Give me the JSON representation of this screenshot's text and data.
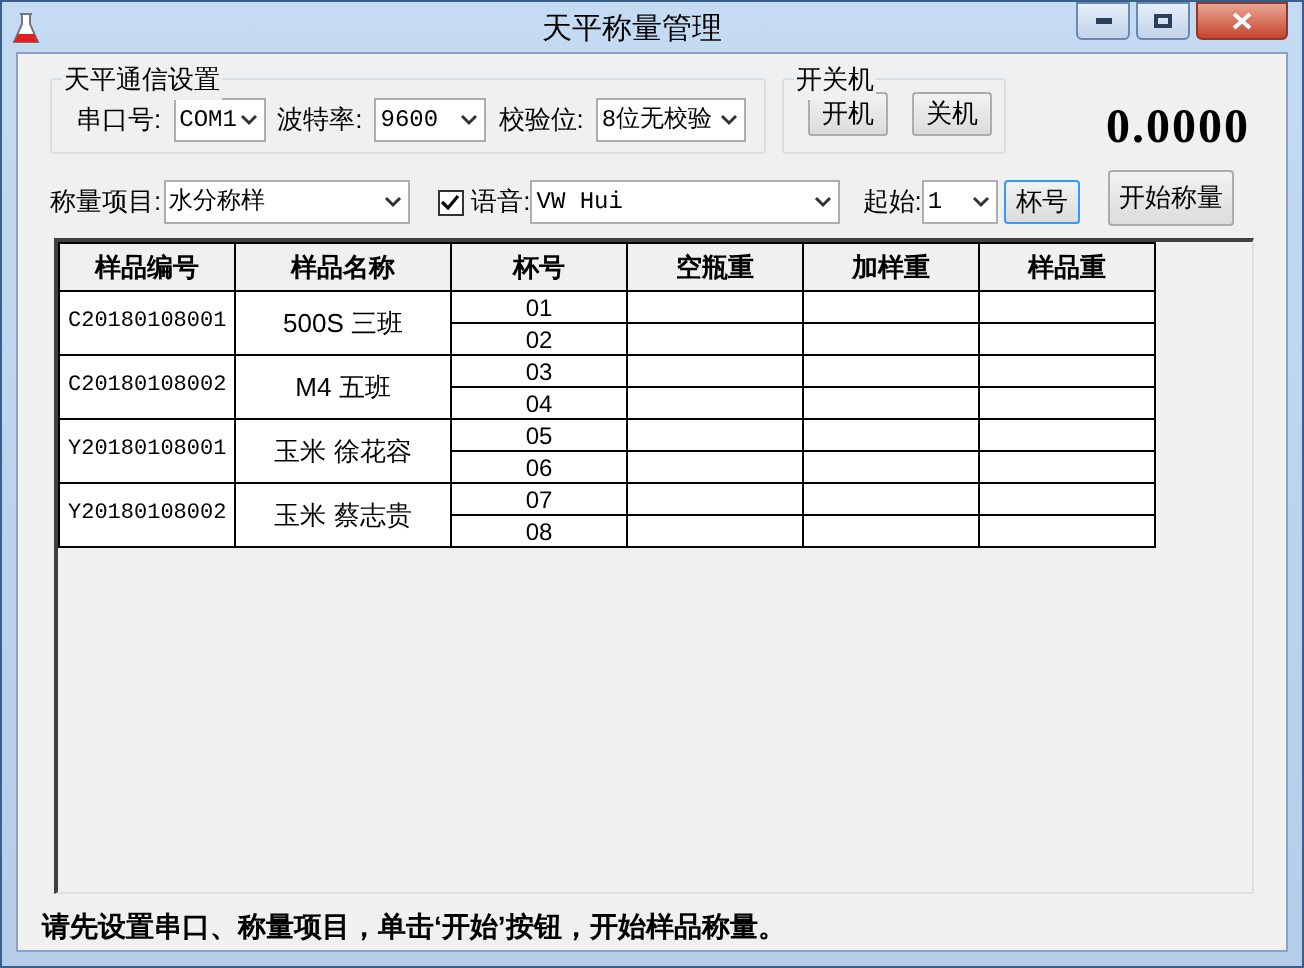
{
  "window": {
    "title": "天平称量管理"
  },
  "comm": {
    "title": "天平通信设置",
    "port_label": "串口号:",
    "port": "COM1",
    "baud_label": "波特率:",
    "baud": "9600",
    "parity_label": "校验位:",
    "parity": "8位无校验"
  },
  "power": {
    "title": "开关机",
    "buttons": [
      "开机",
      "关机"
    ]
  },
  "reading": "0.0000",
  "project": {
    "label": "称量项目:",
    "value": "水分称样"
  },
  "voice": {
    "checked": true,
    "label": "语音:",
    "value": "VW Hui"
  },
  "start": {
    "label": "起始:",
    "value": "1"
  },
  "cup_button": "杯号",
  "start_button": "开始称量",
  "table": {
    "columns": [
      "样品编号",
      "样品名称",
      "杯号",
      "空瓶重",
      "加样重",
      "样品重"
    ],
    "rows": [
      {
        "id": "C20180108001",
        "name": "500S 三班",
        "cups": [
          "01",
          "02"
        ]
      },
      {
        "id": "C20180108002",
        "name": "M4 五班",
        "cups": [
          "03",
          "04"
        ]
      },
      {
        "id": "Y20180108001",
        "name": "玉米 徐花容",
        "cups": [
          "05",
          "06"
        ]
      },
      {
        "id": "Y20180108002",
        "name": "玉米 蔡志贵",
        "cups": [
          "07",
          "08"
        ]
      }
    ]
  },
  "status_bar": "请先设置串口、称量项目，单击‘开始’按钮，开始样品称量。"
}
